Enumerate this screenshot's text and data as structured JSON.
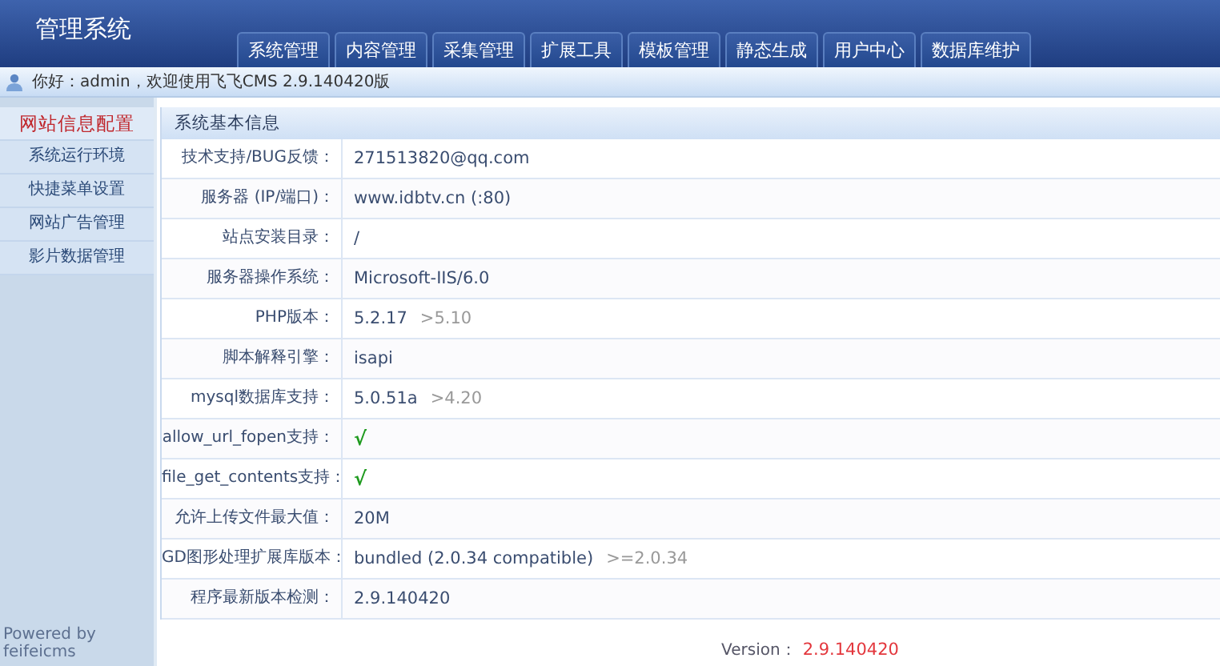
{
  "header": {
    "title": "管理系统"
  },
  "tabs": [
    {
      "label": "系统管理",
      "selected": false
    },
    {
      "label": "内容管理",
      "selected": false
    },
    {
      "label": "采集管理",
      "selected": false
    },
    {
      "label": "扩展工具",
      "selected": false
    },
    {
      "label": "模板管理",
      "selected": false
    },
    {
      "label": "静态生成",
      "selected": false
    },
    {
      "label": "用户中心",
      "selected": false
    },
    {
      "label": "数据库维护",
      "selected": false
    }
  ],
  "welcome": "你好：admin，欢迎使用飞飞CMS 2.9.140420版",
  "sidebar": {
    "items": [
      {
        "label": "网站信息配置",
        "selected": true
      },
      {
        "label": "系统运行环境",
        "selected": false
      },
      {
        "label": "快捷菜单设置",
        "selected": false
      },
      {
        "label": "网站广告管理",
        "selected": false
      },
      {
        "label": "影片数据管理",
        "selected": false
      }
    ],
    "footer": "Powered by feifeicms"
  },
  "panel": {
    "title": "系统基本信息",
    "rows": [
      {
        "label": "技术支持/BUG反馈：",
        "kind": "text",
        "value": "271513820@qq.com"
      },
      {
        "label": "服务器 (IP/端口)：",
        "kind": "text",
        "value": "www.idbtv.cn (:80)"
      },
      {
        "label": "站点安装目录：",
        "kind": "text",
        "value": "/"
      },
      {
        "label": "服务器操作系统：",
        "kind": "text",
        "value": "Microsoft-IIS/6.0"
      },
      {
        "label": "PHP版本：",
        "kind": "text",
        "value": "5.2.17",
        "requirement": ">5.10"
      },
      {
        "label": "脚本解释引擎：",
        "kind": "text",
        "value": "isapi"
      },
      {
        "label": "mysql数据库支持：",
        "kind": "text",
        "value": "5.0.51a",
        "requirement": ">4.20"
      },
      {
        "label": "allow_url_fopen支持：",
        "kind": "check",
        "value": "√"
      },
      {
        "label": "file_get_contents支持：",
        "kind": "check",
        "value": "√"
      },
      {
        "label": "允许上传文件最大值：",
        "kind": "text",
        "value": "20M"
      },
      {
        "label": "GD图形处理扩展库版本：",
        "kind": "text",
        "value": "bundled (2.0.34 compatible)",
        "requirement": ">=2.0.34"
      },
      {
        "label": "程序最新版本检测：",
        "kind": "text",
        "value": "2.9.140420"
      }
    ]
  },
  "version": {
    "label": "Version：",
    "value": "2.9.140420"
  }
}
